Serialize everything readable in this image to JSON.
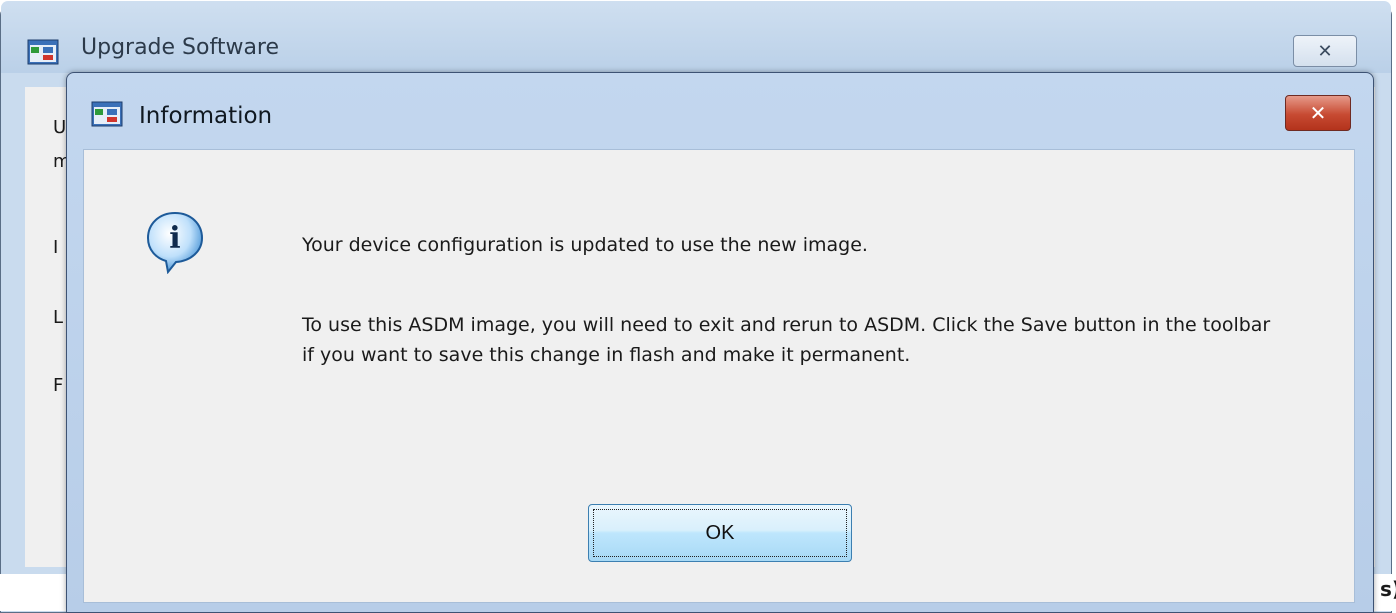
{
  "background_window": {
    "title": "Upgrade Software",
    "close_glyph": "✕",
    "partial_letters": [
      "U",
      "m",
      "I",
      "L",
      "F"
    ],
    "partial_edge_text": "s)"
  },
  "dialog": {
    "title": "Information",
    "close_glyph": "✕",
    "icon": "info-icon",
    "message_line1": "Your device configuration is updated to use the new image.",
    "message_line2": "To use this ASDM image, you will need to exit and rerun to ASDM. Click the Save button in the toolbar if you want to save this change in flash and make it permanent.",
    "ok_label": "OK"
  },
  "colors": {
    "title_bar": "#bad0e8",
    "close_red": "#c74a32",
    "dialog_body": "#f0f0f0",
    "button_blue": "#bee6fd"
  }
}
